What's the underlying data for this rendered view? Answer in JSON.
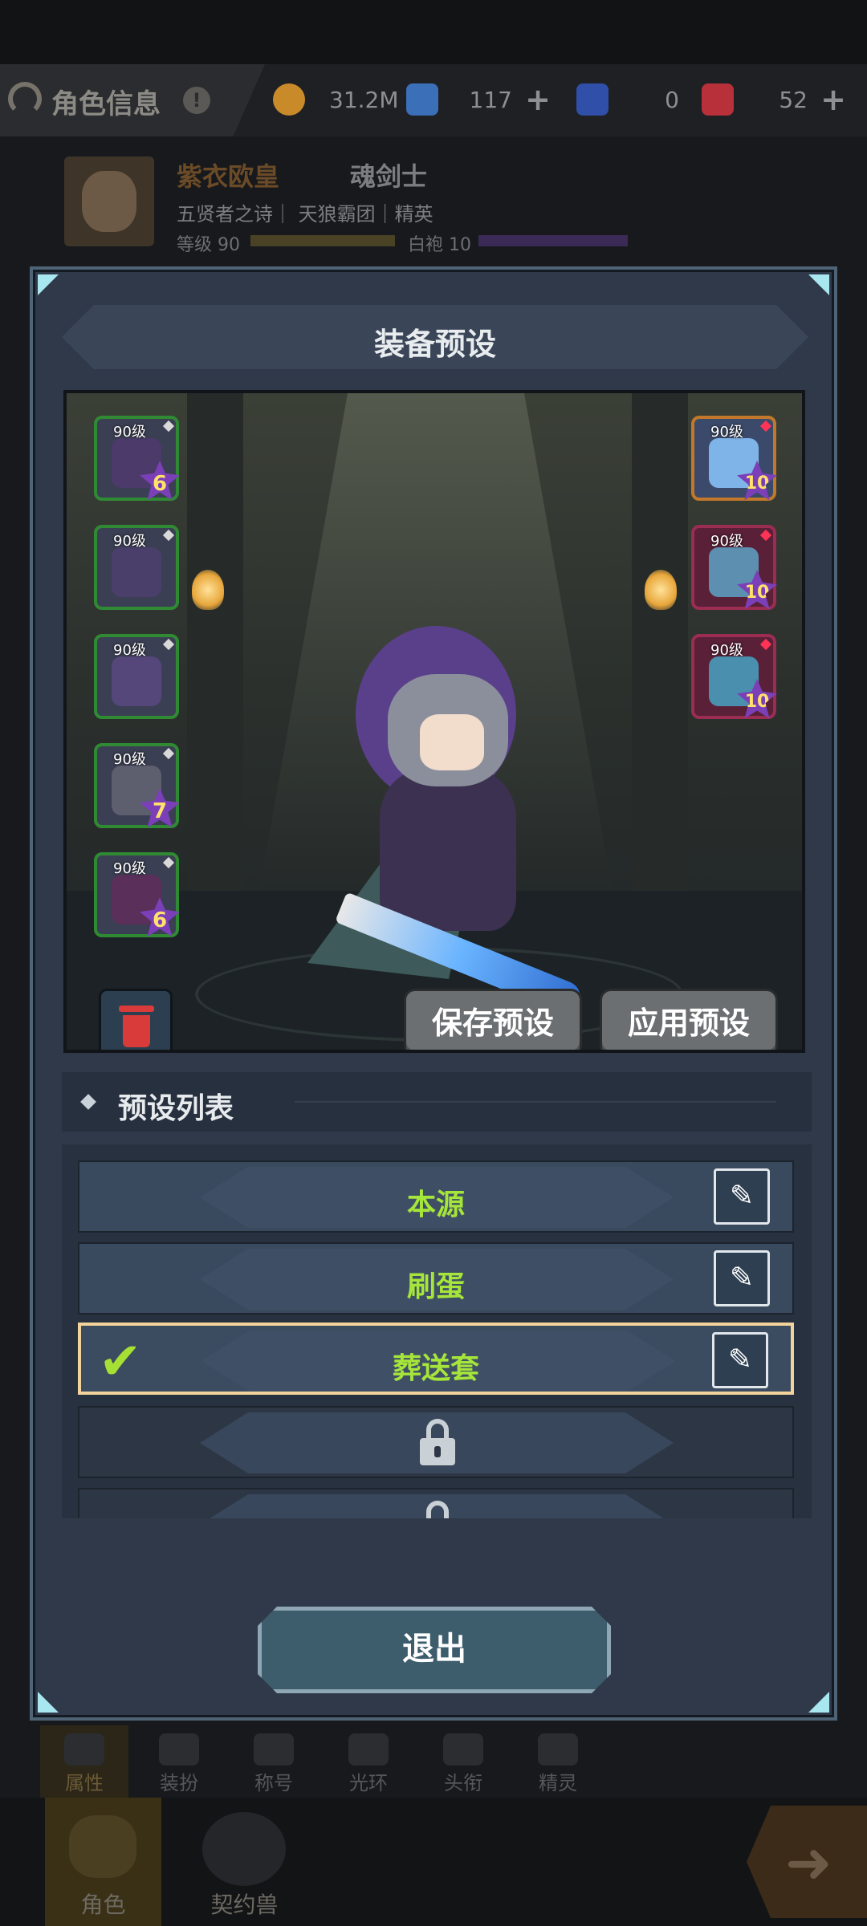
{
  "header": {
    "title": "角色信息",
    "currencies": [
      {
        "name": "gold",
        "value": "31.2M",
        "color": "#c98a2a"
      },
      {
        "name": "crystal",
        "value": "117",
        "color": "#3b6fb8"
      },
      {
        "name": "blue-ticket",
        "value": "0",
        "color": "#2f4fa8"
      },
      {
        "name": "red-ticket",
        "value": "52",
        "color": "#b8303a"
      }
    ]
  },
  "character": {
    "name": "紫衣欧皇",
    "class": "魂剑士",
    "info": "五贤者之诗｜ 天狼霸团｜精英",
    "level_label": "等级 90",
    "white_robe_label": "白袍 10"
  },
  "modal": {
    "title": "装备预设",
    "left_slots": [
      {
        "level": "90级",
        "stars": "6",
        "rarity": "green"
      },
      {
        "level": "90级",
        "stars": "",
        "rarity": "green"
      },
      {
        "level": "90级",
        "stars": "",
        "rarity": "green"
      },
      {
        "level": "90级",
        "stars": "7",
        "rarity": "green"
      },
      {
        "level": "90级",
        "stars": "6",
        "rarity": "green"
      }
    ],
    "right_slots": [
      {
        "level": "90级",
        "stars": "10",
        "rarity": "orange"
      },
      {
        "level": "90级",
        "stars": "10",
        "rarity": "red"
      },
      {
        "level": "90级",
        "stars": "10",
        "rarity": "red"
      }
    ],
    "save_label": "保存预设",
    "apply_label": "应用预设",
    "list_title": "预设列表",
    "presets": [
      {
        "name": "本源",
        "selected": false,
        "locked": false
      },
      {
        "name": "刷蛋",
        "selected": false,
        "locked": false
      },
      {
        "name": "葬送套",
        "selected": true,
        "locked": false
      },
      {
        "name": "",
        "selected": false,
        "locked": true
      },
      {
        "name": "",
        "selected": false,
        "locked": true
      }
    ],
    "exit_label": "退出"
  },
  "bottom_tabs": [
    "属性",
    "装扮",
    "称号",
    "光环",
    "头衔",
    "精灵"
  ],
  "nav": {
    "role": "角色",
    "pet": "契约兽"
  }
}
